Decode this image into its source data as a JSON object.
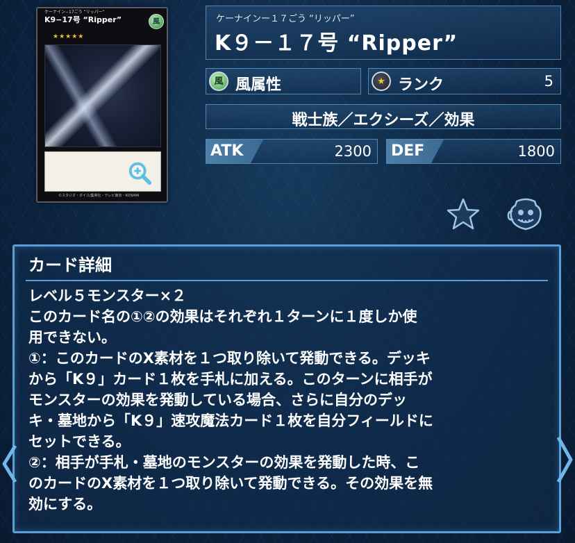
{
  "card_image": {
    "ruby": "ケーナイン−17ごう “リッパー”",
    "name": "K9−17号 “Ripper”",
    "attribute_symbol": "風",
    "stars": "★★★★★",
    "footer": "©スタジオ・ダイス/集英社・テレビ東京・KONAMI",
    "zoom_icon": "magnifier-plus-icon"
  },
  "card_info": {
    "ruby": "ケーナインー１７ごう “リッパー”",
    "name": "K９－１７号 “Ripper”",
    "attribute": {
      "icon_text": "風",
      "label": "風属性"
    },
    "rank": {
      "label": "ランク",
      "value": "5"
    },
    "type_line": "戦士族／エクシーズ／効果",
    "atk": {
      "label": "ATK",
      "value": "2300"
    },
    "def": {
      "label": "DEF",
      "value": "1800"
    }
  },
  "actions": {
    "favorite_icon": "star-icon",
    "deck_icon": "pot-icon"
  },
  "detail": {
    "title": "カード詳細",
    "lines": [
      "レベル５モンスター×２",
      "このカード名の①②の効果はそれぞれ１ターンに１度しか使",
      "用できない。",
      "①：このカードのX素材を１つ取り除いて発動できる。デッキ",
      "から「K９」カード１枚を手札に加える。このターンに相手が",
      "モンスターの効果を発動している場合、さらに自分のデッ",
      "キ・墓地から「K９」速攻魔法カード１枚を自分フィールドに",
      "セットできる。",
      "②：相手が手札・墓地のモンスターの効果を発動した時、こ",
      "のカードのX素材を１つ取り除いて発動できる。その効果を無",
      "効にする。"
    ]
  },
  "navigation": {
    "prev_icon": "chevron-left-icon",
    "next_icon": "chevron-right-icon"
  },
  "colors": {
    "accent": "#5aa0d8",
    "background": "#0c2440",
    "star": "#f2c230"
  }
}
